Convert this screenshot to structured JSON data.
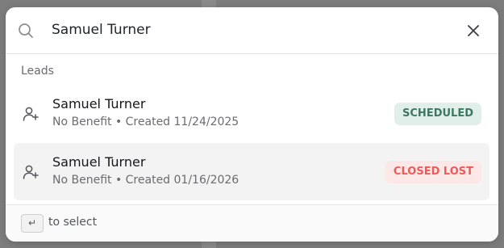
{
  "search": {
    "value": "Samuel Turner",
    "icon": "search-icon"
  },
  "section": {
    "label": "Leads"
  },
  "results": [
    {
      "name": "Samuel Turner",
      "meta": "No Benefit • Created 11/24/2025",
      "status": "SCHEDULED",
      "status_color": "#3e7762",
      "icon": "add-user-icon",
      "selected": false
    },
    {
      "name": "Samuel Turner",
      "meta": "No Benefit • Created 01/16/2026",
      "status": "CLOSED LOST",
      "status_color": "#ec5a5a",
      "icon": "add-user-icon",
      "selected": true
    }
  ],
  "footer": {
    "key": "↵",
    "hint": "to select"
  }
}
